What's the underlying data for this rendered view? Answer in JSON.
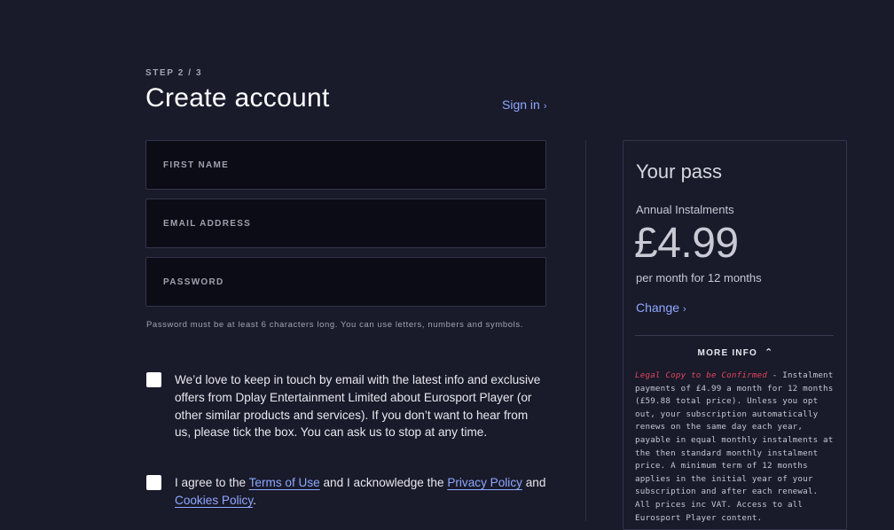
{
  "header": {
    "step": "STEP 2 / 3",
    "title": "Create account",
    "sign_in": "Sign in",
    "chevron": "›"
  },
  "form": {
    "first_name_placeholder": "FIRST NAME",
    "email_placeholder": "EMAIL ADDRESS",
    "password_placeholder": "PASSWORD",
    "password_hint": "Password must be at least 6 characters long. You can use letters, numbers and symbols.",
    "marketing_text": "We’d love to keep in touch by email with the latest info and exclusive offers from Dplay Entertainment Limited about Eurosport Player (or other similar products and services). If you don’t want to hear from us, please tick the box. You can ask us to stop at any time.",
    "terms_pre": "I agree to the ",
    "terms_link": "Terms of Use",
    "terms_mid": " and I acknowledge the ",
    "privacy_link": "Privacy Policy",
    "terms_and": " and ",
    "cookies_link": "Cookies Policy",
    "terms_end": "."
  },
  "pass": {
    "title": "Your pass",
    "plan": "Annual Instalments",
    "price": "£4.99",
    "per": "per month for 12 months",
    "change": "Change",
    "more_info": "MORE INFO",
    "caret": "⌃",
    "legal_red": "Legal Copy to be Confirmed",
    "legal_text": " - Instalment payments of £4.99 a month for 12 months (£59.88 total price). Unless you opt out, your subscription automatically renews on the same day each year, payable in equal monthly instalments at the then standard monthly instalment price. A minimum term of 12 months applies in the initial year of your subscription and after each renewal. All prices inc VAT. Access to all Eurosport Player content."
  },
  "colors": {
    "background": "#191a2a",
    "field": "#0c0c16",
    "link": "#8ea8ff",
    "legal_red": "#e0455d"
  }
}
